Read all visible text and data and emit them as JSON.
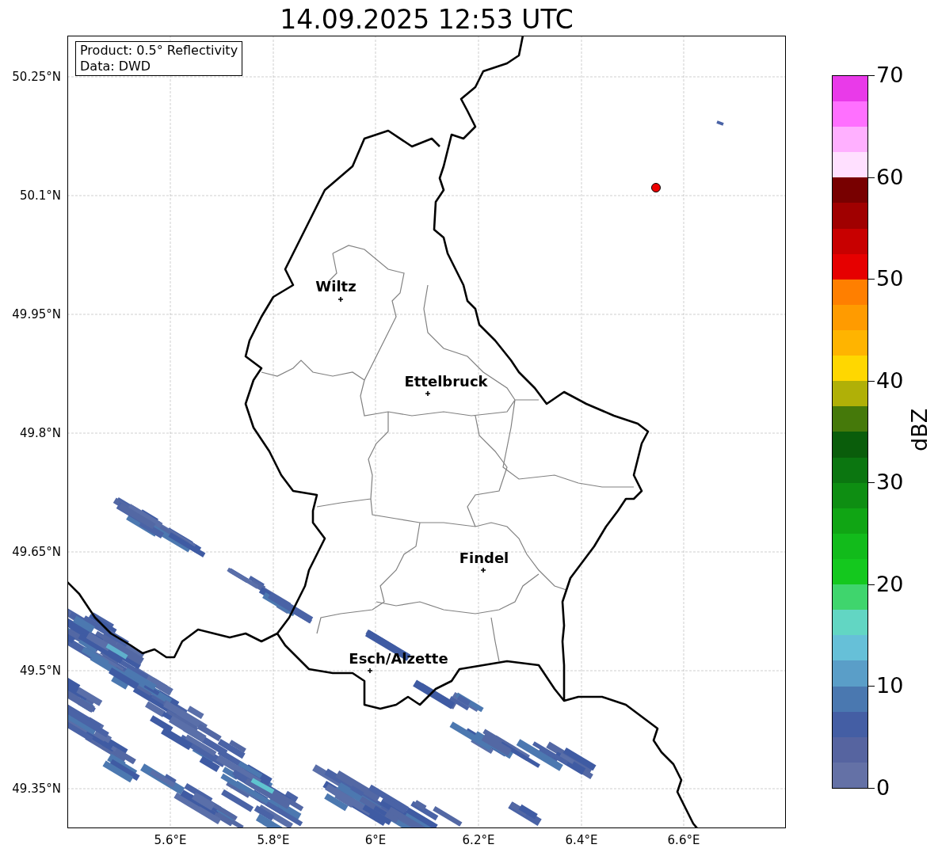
{
  "title": "14.09.2025 12:53 UTC",
  "info_box": {
    "lines": [
      "Product: 0.5° Reflectivity",
      "Data: DWD"
    ]
  },
  "map": {
    "lat_ticks": [
      "50.25°N",
      "50.1°N",
      "49.95°N",
      "49.8°N",
      "49.65°N",
      "49.5°N",
      "49.35°N"
    ],
    "lon_ticks": [
      "5.6°E",
      "5.8°E",
      "6°E",
      "6.2°E",
      "6.4°E",
      "6.6°E"
    ],
    "cities": [
      {
        "name": "Wiltz"
      },
      {
        "name": "Ettelbruck"
      },
      {
        "name": "Findel"
      },
      {
        "name": "Esch/Alzette"
      }
    ]
  },
  "colorbar": {
    "label": "dBZ",
    "ticks": [
      "70",
      "60",
      "50",
      "40",
      "30",
      "20",
      "10",
      "0"
    ],
    "bins": [
      {
        "color": "#6471a6"
      },
      {
        "color": "#5664a0"
      },
      {
        "color": "#445ea4"
      },
      {
        "color": "#4a78b0"
      },
      {
        "color": "#5a9ec8"
      },
      {
        "color": "#66c0d8"
      },
      {
        "color": "#62d6c3"
      },
      {
        "color": "#3fd56d"
      },
      {
        "color": "#14c81e"
      },
      {
        "color": "#12bb1b"
      },
      {
        "color": "#10a514"
      },
      {
        "color": "#0e8e12"
      },
      {
        "color": "#0b7610"
      },
      {
        "color": "#0a5d0b"
      },
      {
        "color": "#45790a"
      },
      {
        "color": "#b0b007"
      },
      {
        "color": "#ffd700"
      },
      {
        "color": "#ffb400"
      },
      {
        "color": "#ff9b00"
      },
      {
        "color": "#ff7f00"
      },
      {
        "color": "#e60000"
      },
      {
        "color": "#c80000"
      },
      {
        "color": "#a00000"
      },
      {
        "color": "#780000"
      },
      {
        "color": "#ffe0ff"
      },
      {
        "color": "#ffb0ff"
      },
      {
        "color": "#ff70ff"
      },
      {
        "color": "#e93ae9"
      }
    ]
  }
}
